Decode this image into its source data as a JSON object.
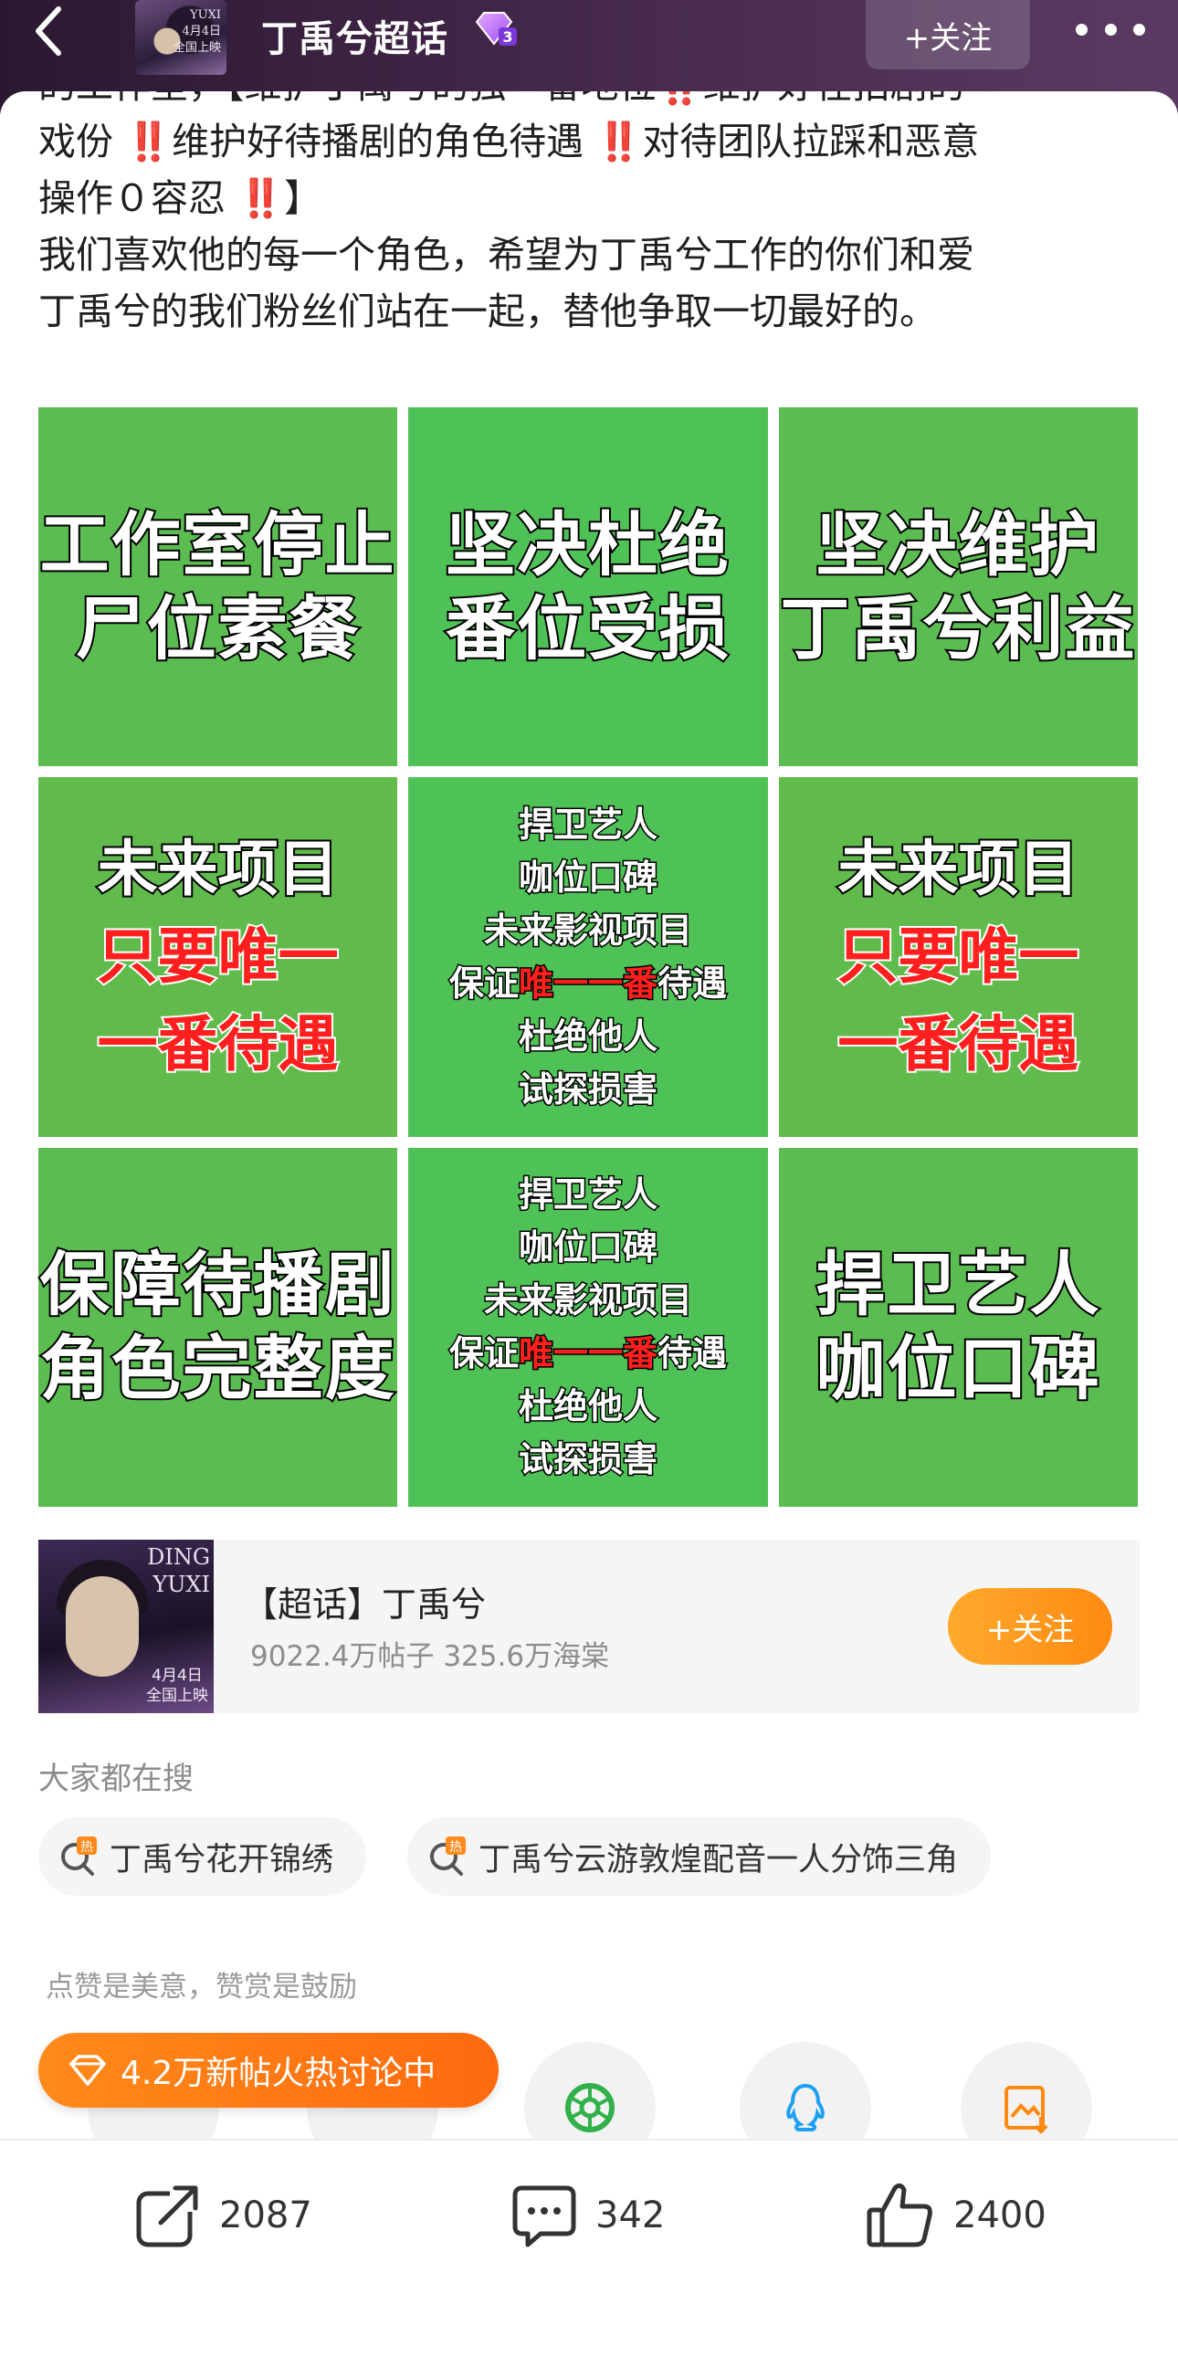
{
  "header": {
    "title": "丁禹兮超话",
    "level": "3",
    "follow_label": "+关注",
    "avatar_text": "YUXI\n4月4日\n全国上映"
  },
  "article": {
    "line1": "的工作室，【维护丁禹兮的独一番地位",
    "line1b": "维护好在拍剧的",
    "line2a": "戏份",
    "line2b": "维护好待播剧的角色待遇",
    "line2c": "对待团队拉踩和恶意",
    "line3a": "操作０容忍",
    "line3b": "】",
    "line4": "我们喜欢他的每一个角色，希望为丁禹兮工作的你们和爱",
    "line5": "丁禹兮的我们粉丝们站在一起，替他争取一切最好的。",
    "bang": "‼️"
  },
  "tiles": {
    "t1": [
      "工作室停止",
      "尸位素餐"
    ],
    "t2": [
      "坚决杜绝",
      "番位受损"
    ],
    "t3": [
      "坚决维护",
      "丁禹兮利益"
    ],
    "t4": [
      "未来项目",
      "只要唯一",
      "一番待遇"
    ],
    "t5": {
      "l1": "捍卫艺人",
      "l2": "咖位口碑",
      "l3": "未来影视项目",
      "l4a": "保证",
      "l4b": "唯一一番",
      "l4c": "待遇",
      "l5": "杜绝他人",
      "l6": "试探损害"
    },
    "t6": [
      "未来项目",
      "只要唯一",
      "一番待遇"
    ],
    "t7": [
      "保障待播剧",
      "角色完整度"
    ],
    "t9": [
      "捍卫艺人",
      "咖位口碑"
    ]
  },
  "topic_card": {
    "name": "【超话】丁禹兮",
    "stats": "9022.4万帖子 325.6万海棠",
    "follow_label": "+关注",
    "image_text_top": "DING\nYUXI",
    "image_text_bottom": "4月4日\n全国上映"
  },
  "search": {
    "title": "大家都在搜",
    "chips": [
      "丁禹兮花开锦绣",
      "丁禹兮云游敦煌配音一人分饰三角"
    ],
    "hot_badge": "热"
  },
  "reward_hint": "点赞是美意，赞赏是鼓励",
  "hot_pill": "4.2万新帖火热讨论中",
  "bottom_bar": {
    "share_count": "2087",
    "comment_count": "342",
    "like_count": "2400"
  },
  "colors": {
    "tile_green": "#5bbc52",
    "accent_orange": "#ff8a12",
    "header_purple": "#432749",
    "warning_red": "#e8322b"
  }
}
